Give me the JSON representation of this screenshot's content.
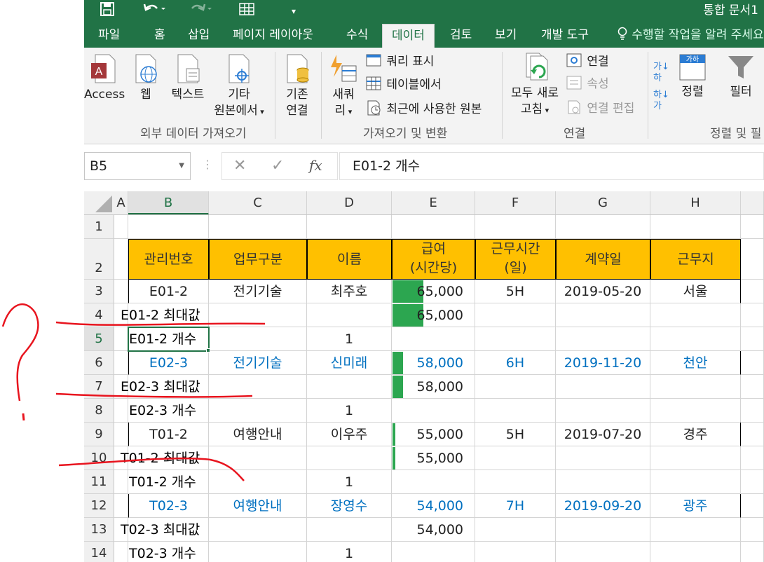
{
  "quick_access": {
    "save_icon": "save-icon",
    "undo_icon": "undo-icon",
    "redo_icon": "redo-icon",
    "table_icon": "table-icon"
  },
  "app_title": "통합 문서1",
  "tabs": [
    {
      "label": "파일"
    },
    {
      "label": "홈"
    },
    {
      "label": "삽입"
    },
    {
      "label": "페이지 레이아웃"
    },
    {
      "label": "수식"
    },
    {
      "label": "데이터"
    },
    {
      "label": "검토"
    },
    {
      "label": "보기"
    },
    {
      "label": "개발 도구"
    }
  ],
  "tell_me": "수행할 작업을 알려 주세요",
  "ribbon": {
    "access": "Access",
    "web": "웹",
    "text": "텍스트",
    "other_line1": "기타",
    "other_line2": "원본에서",
    "existing_line1": "기존",
    "existing_line2": "연결",
    "new_query_line1": "새쿼",
    "new_query_line2": "리",
    "show_queries": "쿼리 표시",
    "from_table": "테이블에서",
    "recent_sources": "최근에 사용한 원본",
    "refresh_line1": "모두 새로",
    "refresh_line2": "고침",
    "connections": "연결",
    "properties": "속성",
    "edit_links": "연결 편집",
    "sort": "정렬",
    "filter": "필터",
    "group_external": "외부 데이터 가져오기",
    "group_transform": "가져오기 및 변환",
    "group_connections": "연결",
    "group_sort": "정렬 및 필"
  },
  "name_box": "B5",
  "formula": "E01-2 개수",
  "columns": [
    "A",
    "B",
    "C",
    "D",
    "E",
    "F",
    "G",
    "H"
  ],
  "rows": [
    "1",
    "2",
    "3",
    "4",
    "5",
    "6",
    "7",
    "8",
    "9",
    "10",
    "11",
    "12",
    "13",
    "14"
  ],
  "headers": {
    "b": "관리번호",
    "c": "업무구분",
    "d": "이름",
    "e1": "급여",
    "e2": "(시간당)",
    "f1": "근무시간",
    "f2": "(일)",
    "g": "계약일",
    "h": "근무지"
  },
  "r3": {
    "b": "E01-2",
    "c": "전기기술",
    "d": "최주호",
    "e": "65,000",
    "f": "5H",
    "g": "2019-05-20",
    "h": "서울",
    "bar": 0.38
  },
  "r4": {
    "label": "E01-2 최대값",
    "e": "65,000",
    "bar": 0.38
  },
  "r5": {
    "label": "E01-2 개수",
    "d": "1"
  },
  "r6": {
    "b": "E02-3",
    "c": "전기기술",
    "d": "신미래",
    "e": "58,000",
    "f": "6H",
    "g": "2019-11-20",
    "h": "천안",
    "bar": 0.13
  },
  "r7": {
    "label": "E02-3 최대값",
    "e": "58,000",
    "bar": 0.13
  },
  "r8": {
    "label": "E02-3 개수",
    "d": "1"
  },
  "r9": {
    "b": "T01-2",
    "c": "여행안내",
    "d": "이우주",
    "e": "55,000",
    "f": "5H",
    "g": "2019-07-20",
    "h": "경주",
    "bar": 0.03
  },
  "r10": {
    "label": "T01-2 최대값",
    "e": "55,000",
    "bar": 0.03
  },
  "r11": {
    "label": "T01-2 개수",
    "d": "1"
  },
  "r12": {
    "b": "T02-3",
    "c": "여행안내",
    "d": "장영수",
    "e": "54,000",
    "f": "7H",
    "g": "2019-09-20",
    "h": "광주"
  },
  "r13": {
    "label": "T02-3 최대값",
    "e": "54,000"
  },
  "r14": {
    "label": "T02-3 개수",
    "d": "1"
  },
  "colors": {
    "excel_green": "#217346",
    "header_fill": "#ffc000",
    "databar": "#2ca650",
    "blue_text": "#0070c0",
    "annotation": "#e8141e"
  }
}
